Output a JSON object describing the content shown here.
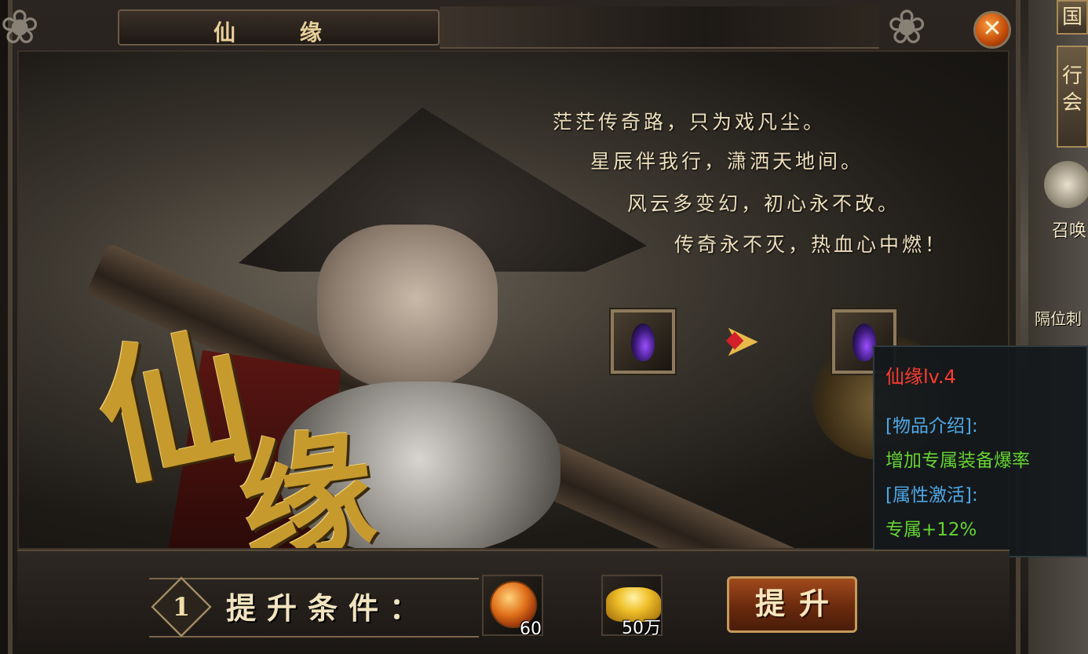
{
  "window": {
    "title": "仙 缘",
    "close_symbol": "✕"
  },
  "banner": {
    "calligraphy": [
      "仙",
      "缘"
    ],
    "poem": [
      "茫茫传奇路，只为戏凡尘。",
      "星辰伴我行，潇洒天地间。",
      "风云多变幻，初心永不改。",
      "传奇永不灭，热血心中燃！"
    ],
    "upgrade_arrow_symbol": "➤"
  },
  "tooltip": {
    "title": "仙缘lv.4",
    "intro_label": "[物品介绍]:",
    "intro_text": "增加专属装备爆率",
    "attr_label": "[属性激活]:",
    "attr_text": "专属+12%"
  },
  "upgrade": {
    "step_number": "1",
    "condition_label": "提升条件：",
    "costs": [
      {
        "icon": "fire-orb-icon",
        "amount": "60"
      },
      {
        "icon": "gold-ingot-icon",
        "amount": "50万"
      }
    ],
    "button_label": "提升"
  },
  "side": {
    "top_button_text": "国",
    "second_button_text": "行会",
    "summon_label": "召唤",
    "skill_label": "隔位刺"
  },
  "colors": {
    "tooltip_title": "#ff3b2f",
    "tooltip_label": "#4ea8e6",
    "tooltip_value": "#66d430",
    "gold_text": "#c79a2e"
  }
}
